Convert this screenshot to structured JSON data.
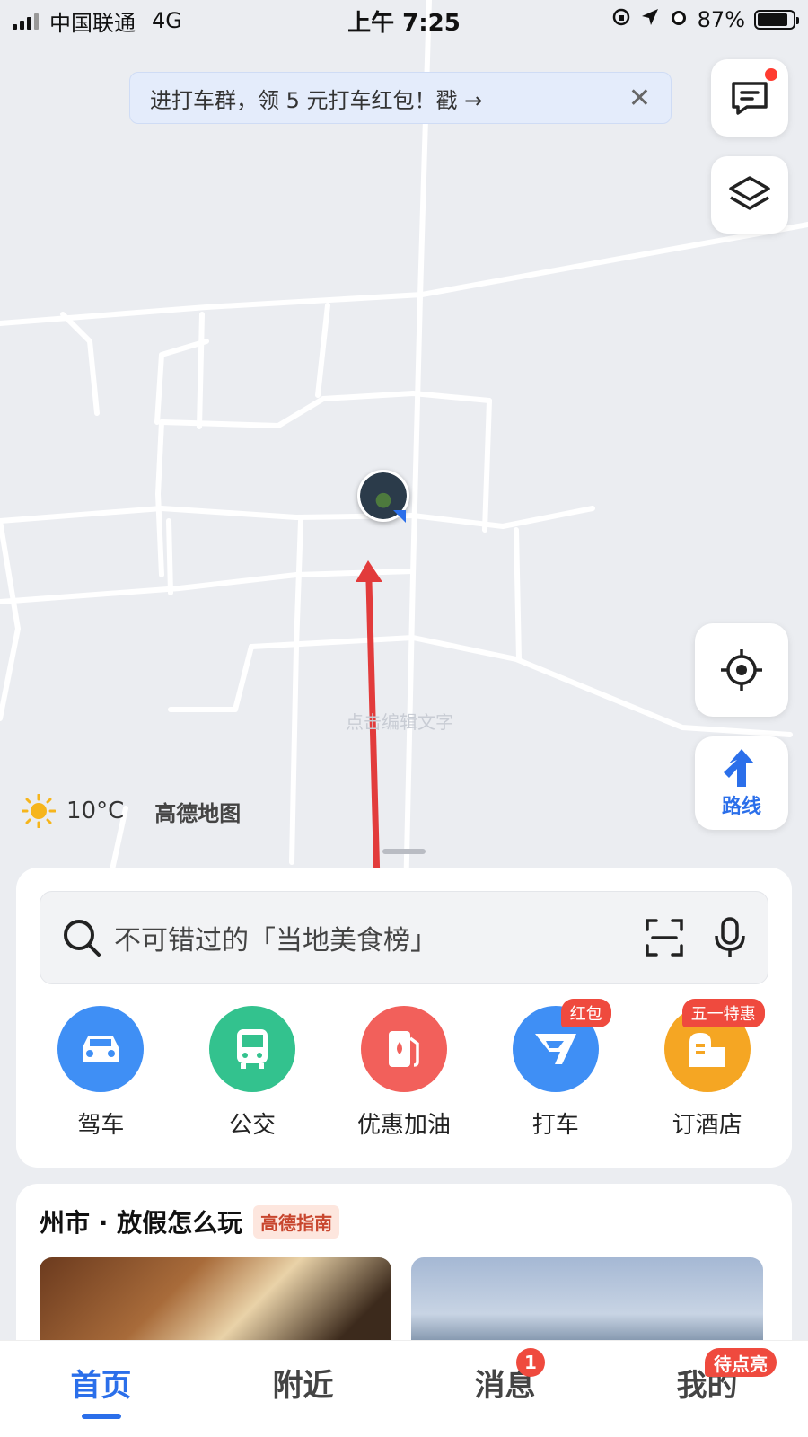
{
  "status_bar": {
    "carrier": "中国联通",
    "network": "4G",
    "time": "上午 7:25",
    "battery": "87%",
    "battery_level": 0.87
  },
  "banner": {
    "text": "进打车群，领 5 元打车红包！戳 →"
  },
  "map": {
    "watermark": "点击编辑文字",
    "user_marker": "user-location-pin"
  },
  "weather": {
    "temperature": "10°C",
    "brand": "高德地图"
  },
  "map_controls": {
    "route_label": "路线"
  },
  "search": {
    "placeholder": "不可错过的「当地美食榜」"
  },
  "quick_actions": [
    {
      "label": "驾车",
      "icon": "car-icon",
      "color": "#3f8ff5",
      "badge": ""
    },
    {
      "label": "公交",
      "icon": "bus-icon",
      "color": "#33c28e",
      "badge": ""
    },
    {
      "label": "优惠加油",
      "icon": "fuel-icon",
      "color": "#f2605b",
      "badge": ""
    },
    {
      "label": "打车",
      "icon": "taxi-icon",
      "color": "#3f8ff5",
      "badge": "红包"
    },
    {
      "label": "订酒店",
      "icon": "hotel-icon",
      "color": "#f5a623",
      "badge": "五一特惠"
    }
  ],
  "guide": {
    "title": "州市 · 放假怎么玩",
    "tag": "高德指南"
  },
  "tabbar": {
    "tabs": [
      {
        "label": "首页",
        "active": true,
        "badge": ""
      },
      {
        "label": "附近",
        "active": false,
        "badge": ""
      },
      {
        "label": "消息",
        "active": false,
        "badge": "1"
      },
      {
        "label": "我的",
        "active": false,
        "badge": "待点亮"
      }
    ]
  },
  "colors": {
    "accent": "#2b6fea",
    "badge_red": "#ef4a3e",
    "annotation_arrow": "#e23b3b"
  }
}
